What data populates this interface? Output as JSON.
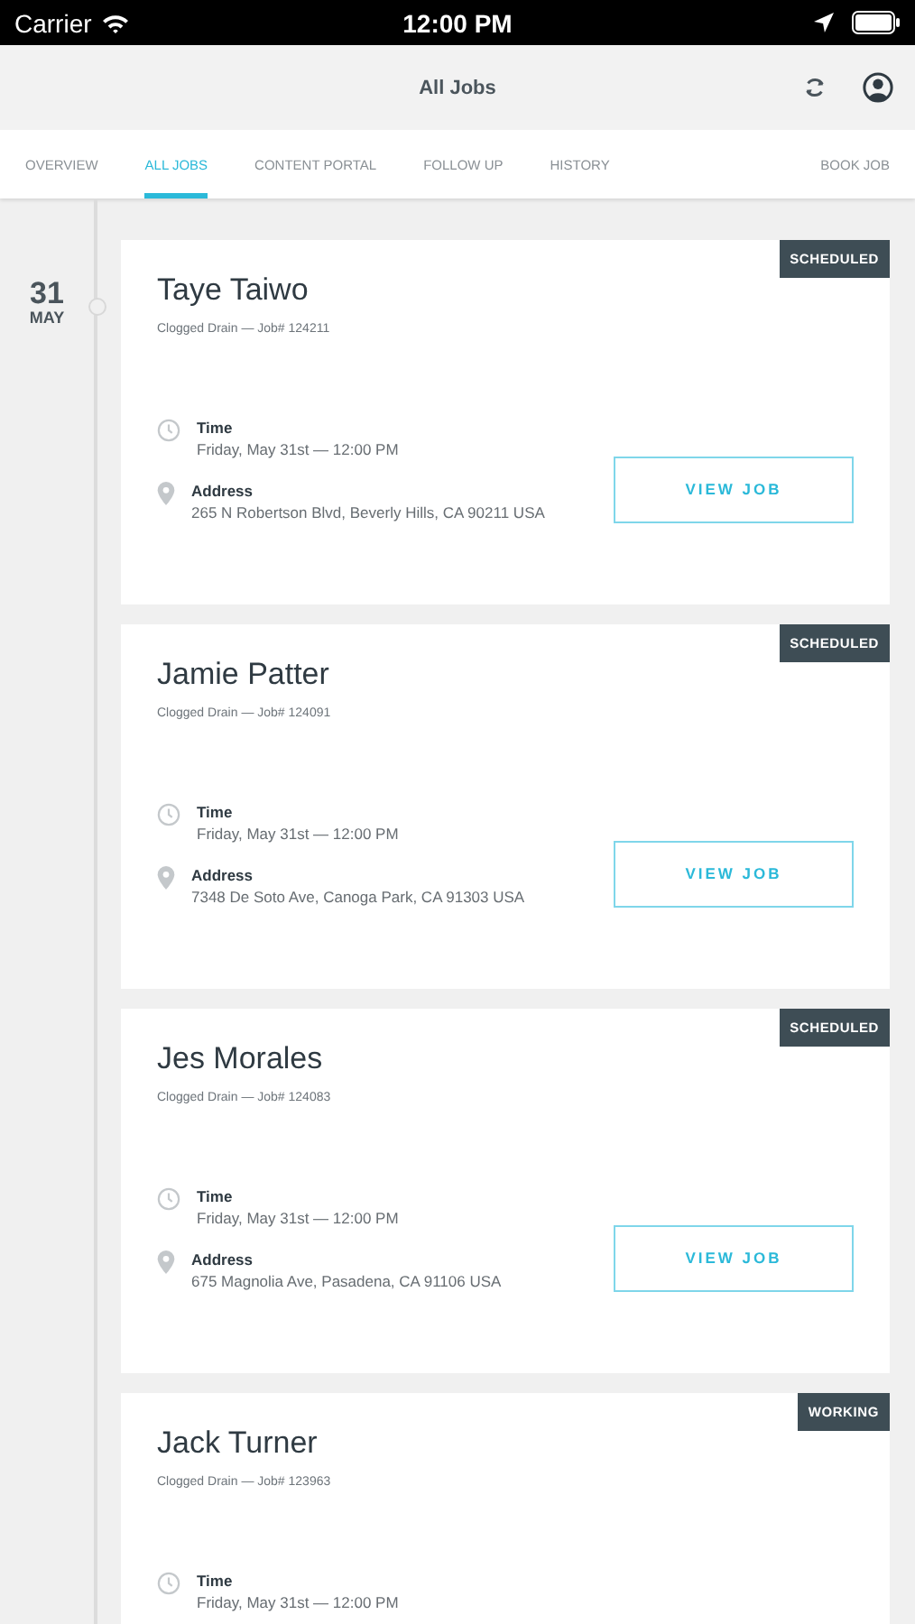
{
  "status_bar": {
    "carrier": "Carrier",
    "time": "12:00 PM"
  },
  "nav": {
    "title": "All Jobs"
  },
  "tabs": [
    {
      "label": "OVERVIEW",
      "selected": false
    },
    {
      "label": "ALL JOBS",
      "selected": true
    },
    {
      "label": "CONTENT PORTAL",
      "selected": false
    },
    {
      "label": "FOLLOW UP",
      "selected": false
    },
    {
      "label": "HISTORY",
      "selected": false
    }
  ],
  "book_job": "BOOK JOB",
  "date": {
    "day": "31",
    "month": "MAY"
  },
  "jobs": [
    {
      "status": "SCHEDULED",
      "name": "Taye Taiwo",
      "subtitle": "Clogged Drain — Job# 124211",
      "time_label": "Time",
      "time": "Friday, May 31st — 12:00 PM",
      "address_label": "Address",
      "address": "265 N Robertson Blvd, Beverly Hills, CA 90211 USA",
      "button": "VIEW JOB"
    },
    {
      "status": "SCHEDULED",
      "name": "Jamie Patter",
      "subtitle": "Clogged Drain — Job# 124091",
      "time_label": "Time",
      "time": "Friday, May 31st — 12:00 PM",
      "address_label": "Address",
      "address": "7348 De Soto Ave, Canoga Park, CA 91303 USA",
      "button": "VIEW JOB"
    },
    {
      "status": "SCHEDULED",
      "name": "Jes Morales",
      "subtitle": "Clogged Drain — Job# 124083",
      "time_label": "Time",
      "time": "Friday, May 31st — 12:00 PM",
      "address_label": "Address",
      "address": "675 Magnolia Ave, Pasadena, CA 91106 USA",
      "button": "VIEW JOB"
    },
    {
      "status": "WORKING",
      "name": "Jack Turner",
      "subtitle": "Clogged Drain — Job# 123963",
      "time_label": "Time",
      "time": "Friday, May 31st — 12:00 PM"
    }
  ]
}
